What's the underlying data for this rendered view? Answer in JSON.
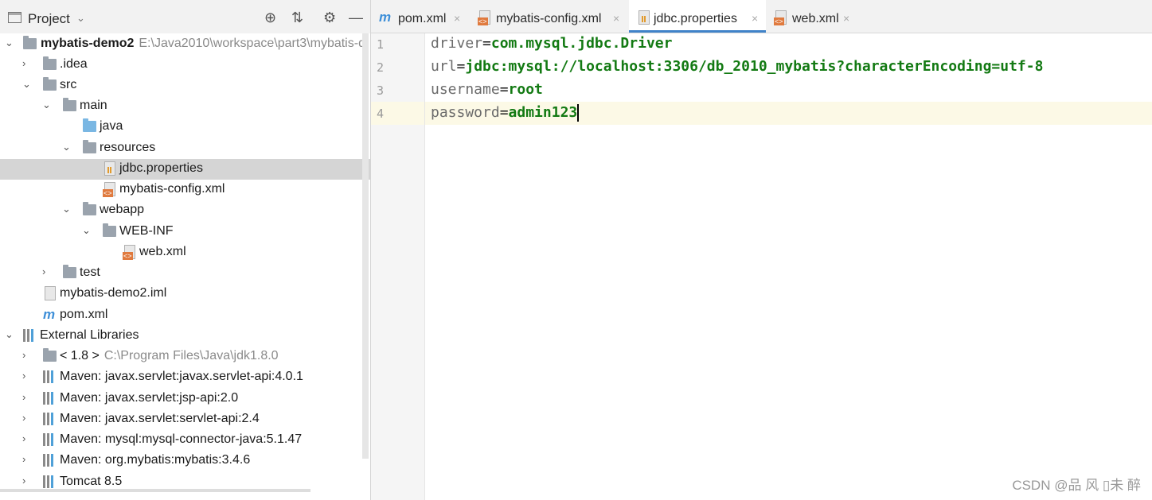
{
  "project_panel": {
    "title": "Project",
    "dropdown_glyph": "⌄",
    "tree": [
      {
        "label": "mybatis-demo2",
        "path": "E:\\Java2010\\workspace\\part3\\mybatis-d",
        "icon": "module",
        "expanded": true
      },
      {
        "label": ".idea",
        "icon": "folder",
        "expanded": false
      },
      {
        "label": "src",
        "icon": "folder",
        "expanded": true
      },
      {
        "label": "main",
        "icon": "folder",
        "expanded": true
      },
      {
        "label": "java",
        "icon": "folder-blue"
      },
      {
        "label": "resources",
        "icon": "folder-resources",
        "expanded": true
      },
      {
        "label": "jdbc.properties",
        "icon": "properties-file",
        "selected": true
      },
      {
        "label": "mybatis-config.xml",
        "icon": "xml-file"
      },
      {
        "label": "webapp",
        "icon": "folder-web",
        "expanded": true
      },
      {
        "label": "WEB-INF",
        "icon": "folder",
        "expanded": true
      },
      {
        "label": "web.xml",
        "icon": "xml-file"
      },
      {
        "label": "test",
        "icon": "folder",
        "expanded": false
      },
      {
        "label": "mybatis-demo2.iml",
        "icon": "iml-file"
      },
      {
        "label": "pom.xml",
        "icon": "maven-file"
      },
      {
        "label": "External Libraries",
        "icon": "library",
        "expanded": true
      },
      {
        "label": "< 1.8 >",
        "path": "C:\\Program Files\\Java\\jdk1.8.0",
        "icon": "jdk",
        "expanded": false
      },
      {
        "label": "Maven: javax.servlet:javax.servlet-api:4.0.1",
        "icon": "library",
        "expanded": false
      },
      {
        "label": "Maven: javax.servlet:jsp-api:2.0",
        "icon": "library",
        "expanded": false
      },
      {
        "label": "Maven: javax.servlet:servlet-api:2.4",
        "icon": "library",
        "expanded": false
      },
      {
        "label": "Maven: mysql:mysql-connector-java:5.1.47",
        "icon": "library",
        "expanded": false
      },
      {
        "label": "Maven: org.mybatis:mybatis:3.4.6",
        "icon": "library",
        "expanded": false
      },
      {
        "label": "Tomcat 8.5",
        "icon": "library",
        "expanded": false
      }
    ]
  },
  "tabs": [
    {
      "label": "pom.xml",
      "icon": "maven-icon"
    },
    {
      "label": "mybatis-config.xml",
      "icon": "xml-icon"
    },
    {
      "label": "jdbc.properties",
      "icon": "properties-icon",
      "active": true
    },
    {
      "label": "web.xml",
      "icon": "xml-icon"
    }
  ],
  "editor": {
    "lines": [
      {
        "num": "1",
        "key": "driver",
        "eq": "=",
        "value": "com.mysql.jdbc.Driver"
      },
      {
        "num": "2",
        "key": "url",
        "eq": "=",
        "value": "jdbc:mysql://localhost:3306/db_2010_mybatis?characterEncoding=utf-8"
      },
      {
        "num": "3",
        "key": "username",
        "eq": "=",
        "value": "root"
      },
      {
        "num": "4",
        "key": "password",
        "eq": "=",
        "value": "admin123"
      }
    ]
  },
  "watermark": "CSDN @品 风 ▯未 醉",
  "colors": {
    "value": "#137a13",
    "key": "#6b6b6b",
    "active_tab_underline": "#4083c9",
    "selection": "#d5d5d5",
    "current_line": "#fcf9e6"
  }
}
